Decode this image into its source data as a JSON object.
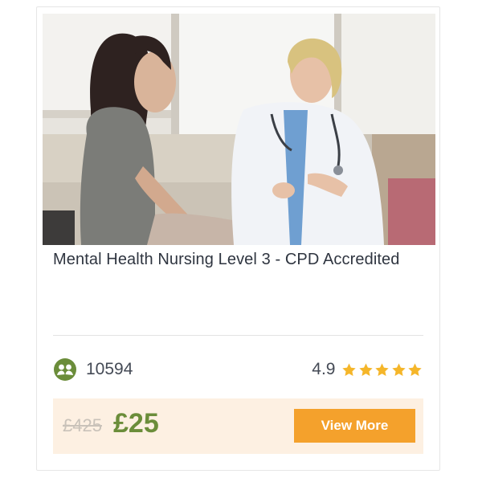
{
  "course": {
    "title": "Mental Health Nursing Level 3 - CPD Accredited",
    "image_description": "Doctor talking with a young patient",
    "enrolled_count": "10594",
    "rating_value": "4.9",
    "stars": 5,
    "old_price": "£425",
    "new_price": "£25",
    "cta_label": "View More"
  },
  "colors": {
    "price_green": "#6b8d3a",
    "cta_orange": "#f4a12c",
    "star_gold": "#f5b62a",
    "price_bar_bg": "#fdf0e2"
  },
  "icons": {
    "enroll": "users-icon",
    "star": "star-icon"
  }
}
